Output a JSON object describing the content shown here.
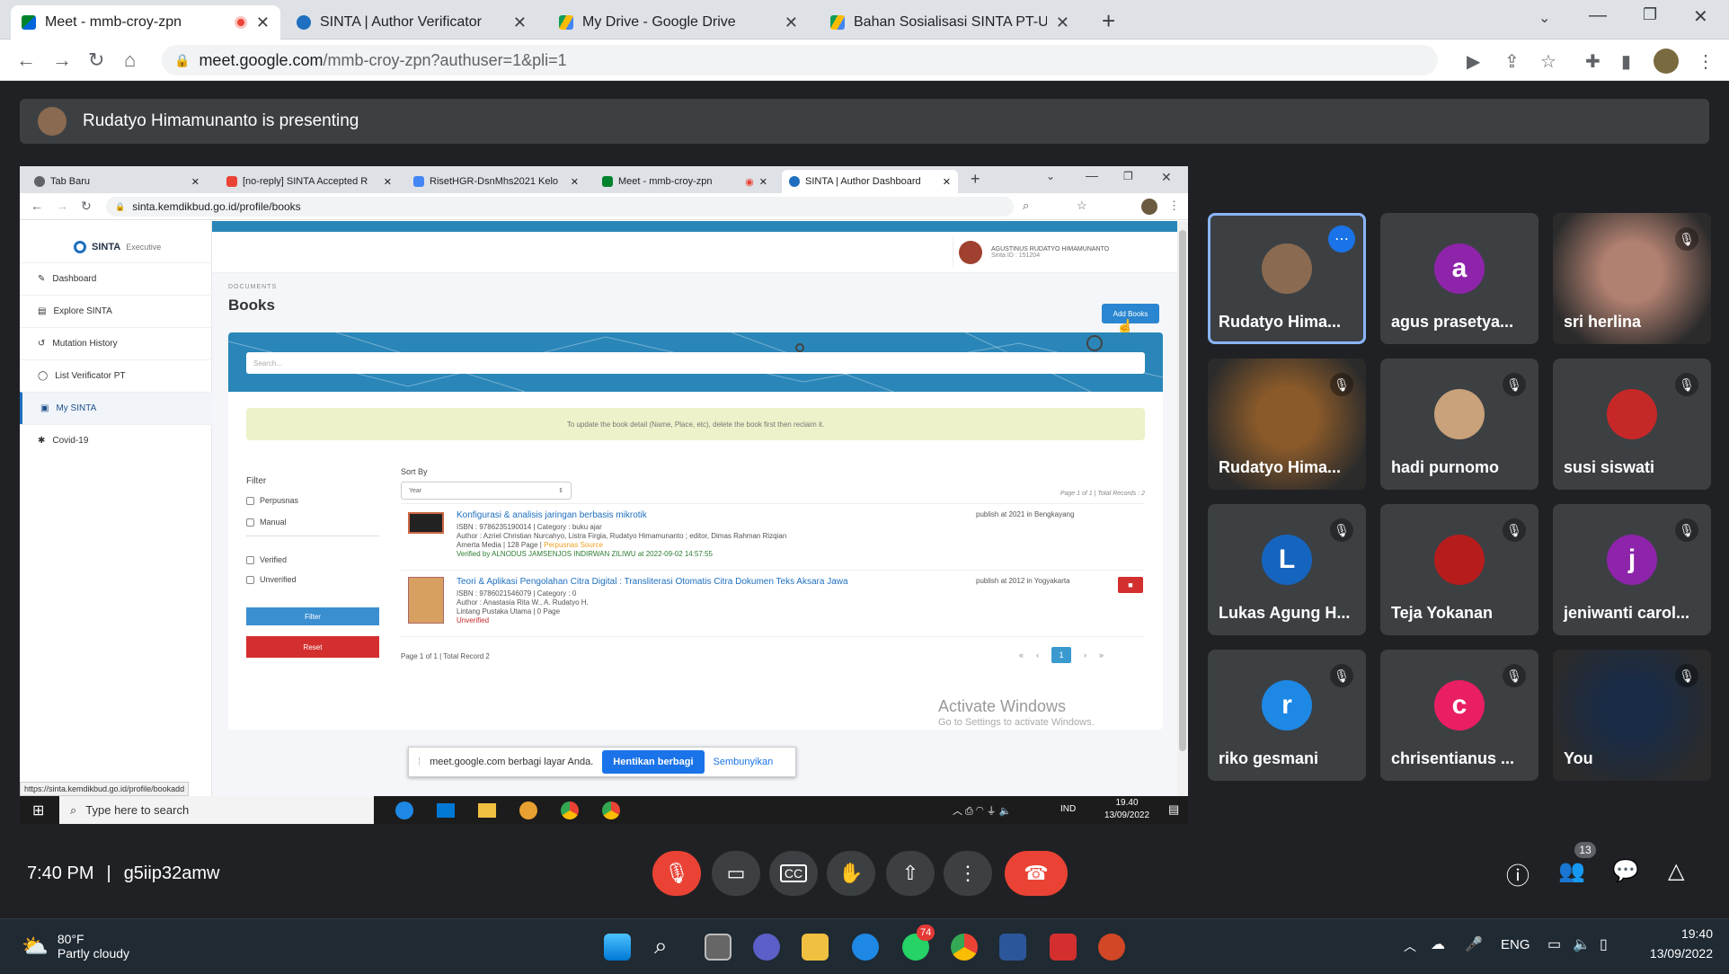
{
  "browser": {
    "tabs": [
      {
        "title": "Meet - mmb-croy-zpn",
        "active": true
      },
      {
        "title": "SINTA | Author Verificator"
      },
      {
        "title": "My Drive - Google Drive"
      },
      {
        "title": "Bahan Sosialisasi SINTA PT-UKRI"
      }
    ],
    "url_host": "meet.google.com",
    "url_path": "/mmb-croy-zpn?authuser=1&pli=1"
  },
  "meet": {
    "presenting_text": "Rudatyo Himamunanto is presenting",
    "time": "7:40 PM",
    "separator": "|",
    "meeting_code": "g5iip32amw",
    "participant_count": "13",
    "tiles": [
      {
        "name": "Rudatyo Hima...",
        "letter": "",
        "color": "#8a6a50",
        "speaking": true
      },
      {
        "name": "agus prasetya...",
        "letter": "a",
        "color": "#8e24aa"
      },
      {
        "name": "sri herlina",
        "letter": "",
        "color": "#b08070",
        "video": true
      },
      {
        "name": "Rudatyo Hima...",
        "letter": "",
        "color": "#8a5a2a",
        "video": true
      },
      {
        "name": "hadi purnomo",
        "letter": "",
        "color": "#c9a17a"
      },
      {
        "name": "susi siswati",
        "letter": "",
        "color": "#c62828"
      },
      {
        "name": "Lukas Agung H...",
        "letter": "L",
        "color": "#1565c0"
      },
      {
        "name": "Teja Yokanan",
        "letter": "",
        "color": "#b71c1c"
      },
      {
        "name": "jeniwanti carol...",
        "letter": "j",
        "color": "#8e24aa"
      },
      {
        "name": "riko gesmani",
        "letter": "r",
        "color": "#1e88e5"
      },
      {
        "name": "chrisentianus ...",
        "letter": "c",
        "color": "#e91e63"
      },
      {
        "name": "You",
        "letter": "",
        "color": "#1a2b45",
        "video": true
      }
    ]
  },
  "inner_browser": {
    "tabs": [
      "Tab Baru",
      "[no-reply] SINTA Accepted R",
      "RisetHGR-DsnMhs2021 Kelo",
      "Meet - mmb-croy-zpn",
      "SINTA | Author Dashboard"
    ],
    "url": "sinta.kemdikbud.go.id/profile/books",
    "status_url": "https://sinta.kemdikbud.go.id/profile/bookadd"
  },
  "sinta": {
    "logo": "SINTA",
    "logo_sub": "Executive",
    "menu": [
      "Dashboard",
      "Explore SINTA",
      "Mutation History",
      "List Verificator PT",
      "My SINTA",
      "Covid-19"
    ],
    "user_name": "AGUSTINUS RUDATYO HIMAMUNANTO",
    "sinta_id": "Sinta ID : 151204",
    "section_label": "DOCUMENTS",
    "page_title": "Books",
    "add_button": "Add Books",
    "search_placeholder": "Search...",
    "notice": "To update the book detail (Name, Place, etc), delete the book first then reclaim it.",
    "filter": {
      "title": "Filter",
      "options": [
        "Perpusnas",
        "Manual",
        "Verified",
        "Unverified"
      ],
      "filter_btn": "Filter",
      "reset_btn": "Reset"
    },
    "sort_by": "Sort By",
    "sort_value": "Year",
    "page_info": "Page 1 of 1 | Total Records : 2",
    "books": [
      {
        "title": "Konfigurasi & analisis jaringan berbasis mikrotik",
        "isbn": "ISBN : 9786235190014   |   Category : buku ajar",
        "author": "Author : Azriel Christian Nurcahyo, Listra Firgia, Rudatyo Himamunanto ; editor, Dimas Rahman Rizqian",
        "publisher": "Amerta Media   |   128 Page   |",
        "source": "Perpusnas Source",
        "status": "Verified by ALNODUS JAMSENJOS INDIRWAN ZILIWU at 2022-09-02 14:57:55",
        "publish": "publish at 2021 in Bengkayang"
      },
      {
        "title": "Teori & Aplikasi Pengolahan Citra Digital : Transliterasi Otomatis Citra Dokumen Teks Aksara Jawa",
        "isbn": "ISBN : 9786021546079   |   Category : 0",
        "author": "Author : Anastasia Rita W., A. Rudatyo H.",
        "publisher": "Lintang Pustaka Utama   |   0 Page",
        "source": "",
        "status": "Unverified",
        "publish": "publish at 2012 in Yogyakarta"
      }
    ],
    "footer_info": "Page 1 of 1 | Total Record 2",
    "page_num": "1",
    "watermark1": "Activate Windows",
    "watermark2": "Go to Settings to activate Windows."
  },
  "share_bar": {
    "text": "meet.google.com berbagi layar Anda.",
    "stop": "Hentikan berbagi",
    "hide": "Sembunyikan"
  },
  "inner_taskbar": {
    "search": "Type here to search",
    "lang": "IND",
    "time": "19.40",
    "date": "13/09/2022"
  },
  "windows": {
    "temp": "80°F",
    "weather": "Partly cloudy",
    "lang": "ENG",
    "time": "19:40",
    "date": "13/09/2022",
    "whatsapp_badge": "74"
  }
}
